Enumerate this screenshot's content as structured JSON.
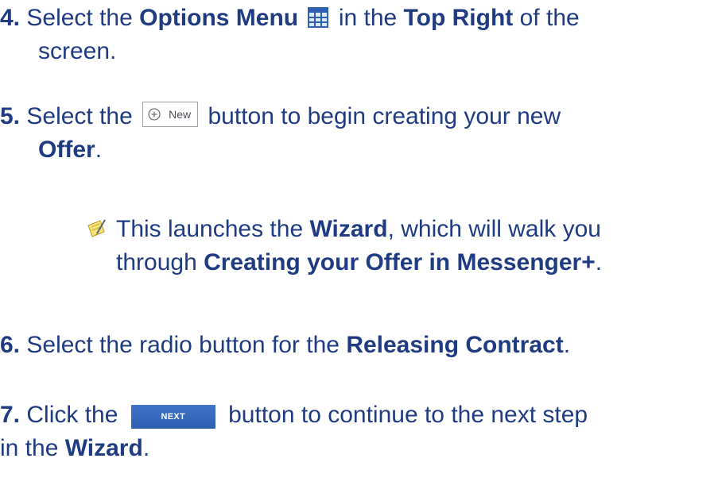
{
  "step4": {
    "number": "4.",
    "pre": "Select the",
    "b1": "Options Menu",
    "mid": "in the",
    "b2": "Top Right",
    "post": "of the",
    "line2": "screen."
  },
  "step5": {
    "number": "5.",
    "pre": "Select the",
    "button_label": "New",
    "post": "button to begin creating your new",
    "b1": "Offer",
    "end": "."
  },
  "note": {
    "pre": "This launches the",
    "b1": "Wizard",
    "post": ", which will walk you",
    "line2_pre": "through",
    "b2": "Creating your Offer in Messenger+",
    "end": "."
  },
  "step6": {
    "number": "6.",
    "pre": "Select the radio button for the",
    "b1": "Releasing Contract",
    "end": "."
  },
  "step7": {
    "number": "7.",
    "pre": "Click the",
    "button_label": "NEXT",
    "post": "button to continue to the next step",
    "line2_pre": "in the",
    "b1": "Wizard",
    "end": "."
  },
  "colors": {
    "text": "#1f3b82",
    "next_button": "#2f5fb0"
  },
  "icons": {
    "options_menu": "grid-icon",
    "new_button": "plus-circle-icon",
    "note": "note-pencil-icon"
  }
}
